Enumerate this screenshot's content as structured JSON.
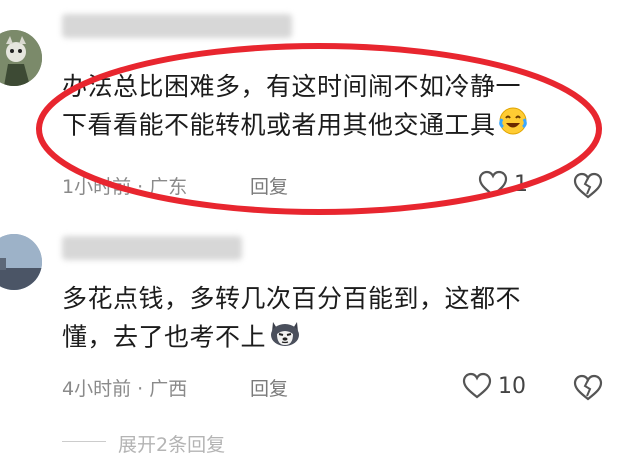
{
  "comments": [
    {
      "text_line1": "办法总比困难多，有这时间闹不如冷静一",
      "text_line2": "下看看能不能转机或者用其他交通工具",
      "time_location": "1小时前 · 广东",
      "reply_label": "回复",
      "like_count": "1",
      "emoji": "crying-laughing-emoji"
    },
    {
      "text_line1": "多花点钱，多转几次百分百能到，这都不",
      "text_line2": "懂，去了也考不上",
      "time_location": "4小时前 · 广西",
      "reply_label": "回复",
      "like_count": "10",
      "emoji": "husky-dog-emoji"
    }
  ],
  "expand_label": "展开2条回复",
  "colors": {
    "highlight_circle": "#e8262f",
    "meta_text": "#8a8a8a"
  }
}
